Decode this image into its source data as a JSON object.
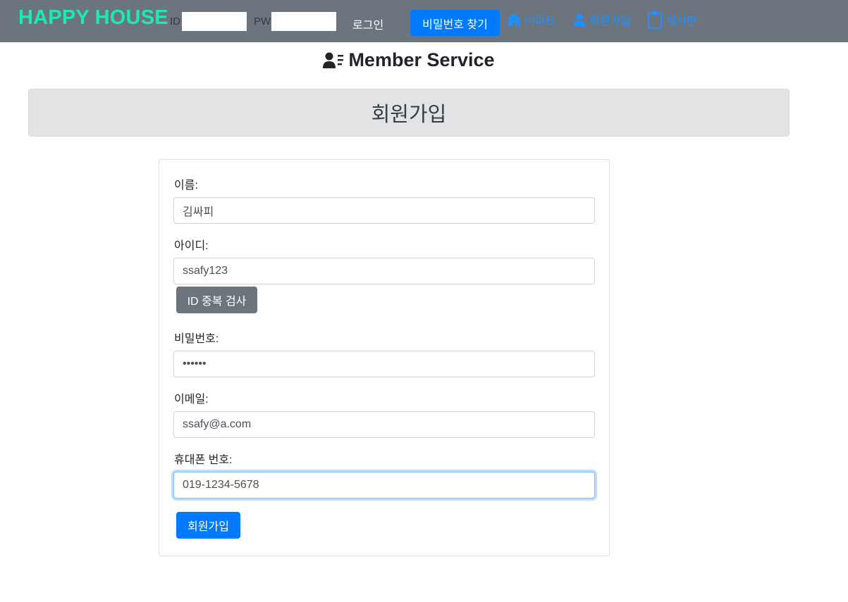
{
  "navbar": {
    "brand": "HAPPY HOUSE",
    "id_label": "ID",
    "id_value": "",
    "pw_label": "PW",
    "pw_value": "",
    "login_link": "로그인",
    "find_password_button": "비밀번호 찾기",
    "nav_items": [
      {
        "label": "아파트",
        "icon": "home-icon"
      },
      {
        "label": "회원가입",
        "icon": "user-icon"
      },
      {
        "label": "게시판",
        "icon": "clipboard-icon"
      }
    ]
  },
  "page": {
    "title": "Member Service",
    "title_icon": "user-list-icon",
    "section_header": "회원가입"
  },
  "form": {
    "name": {
      "label": "이름:",
      "value": "김싸피"
    },
    "userid": {
      "label": "아이디:",
      "value": "ssafy123"
    },
    "id_check_button": "ID 중복 검사",
    "password": {
      "label": "비밀번호:",
      "value": "••••••"
    },
    "email": {
      "label": "이메일:",
      "value": "ssafy@a.com"
    },
    "phone": {
      "label": "휴대폰 번호:",
      "value": "019-1234-5678"
    },
    "submit_button": "회원가입"
  },
  "colors": {
    "navbar_bg": "#6c757d",
    "brand": "#1de9b6",
    "primary": "#007bff",
    "secondary": "#6c757d",
    "nav_link": "#1e90ff",
    "header_bg": "#e2e3e5"
  }
}
